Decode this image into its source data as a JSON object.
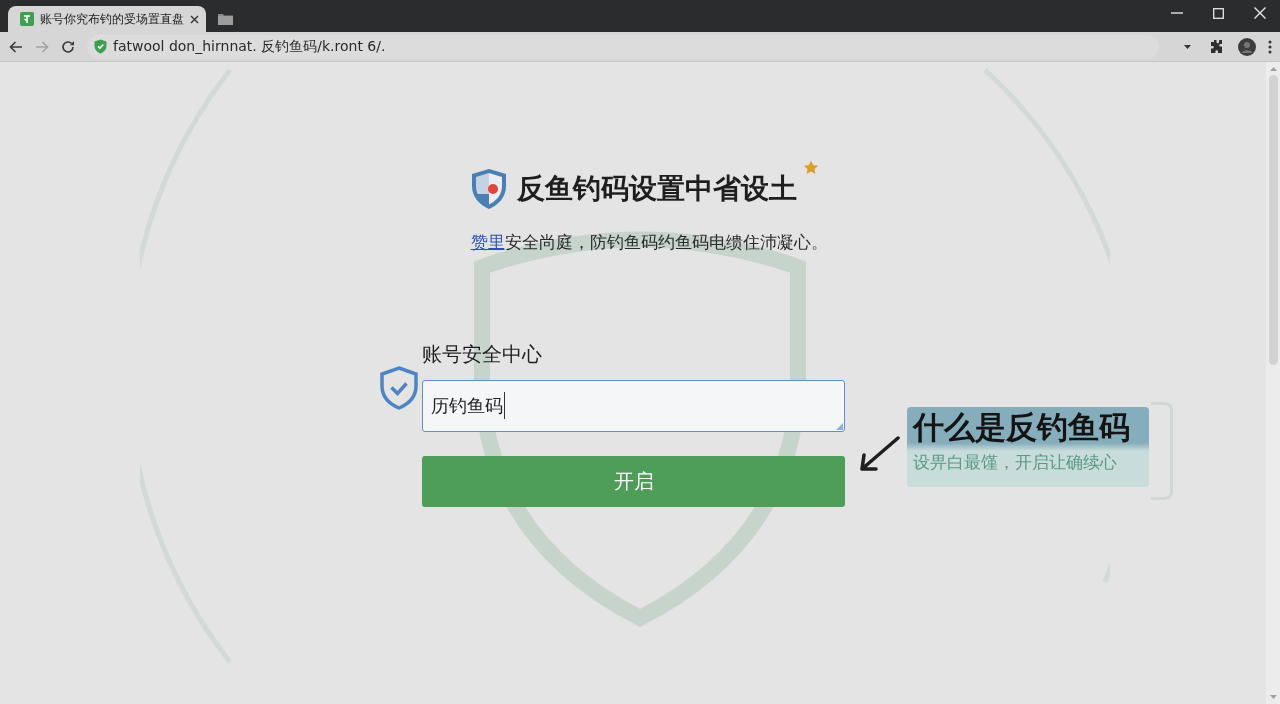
{
  "browser": {
    "tabs": [
      {
        "title": "账号你究布钓的受场置直盘",
        "selected": true
      }
    ],
    "nav": [
      {
        "kind": "back",
        "disabled": false
      },
      {
        "kind": "forward",
        "disabled": true
      },
      {
        "kind": "reload",
        "disabled": false
      }
    ],
    "url": "fatwool don_hirnnat. 反钓鱼码/k.ront 6/."
  },
  "page": {
    "title": "反鱼钓码设置中省设土",
    "subtitle": {
      "link": "赞里",
      "text": "安全尚庭，防钓鱼码约鱼码电缋住沛凝心。"
    },
    "form": {
      "label": "账号安全中心",
      "value": "历钓鱼码",
      "focused": true,
      "button": "开启"
    },
    "callout": {
      "title": "什么是反钓鱼码",
      "text": "设畀白最馑，开启让确续心"
    }
  }
}
